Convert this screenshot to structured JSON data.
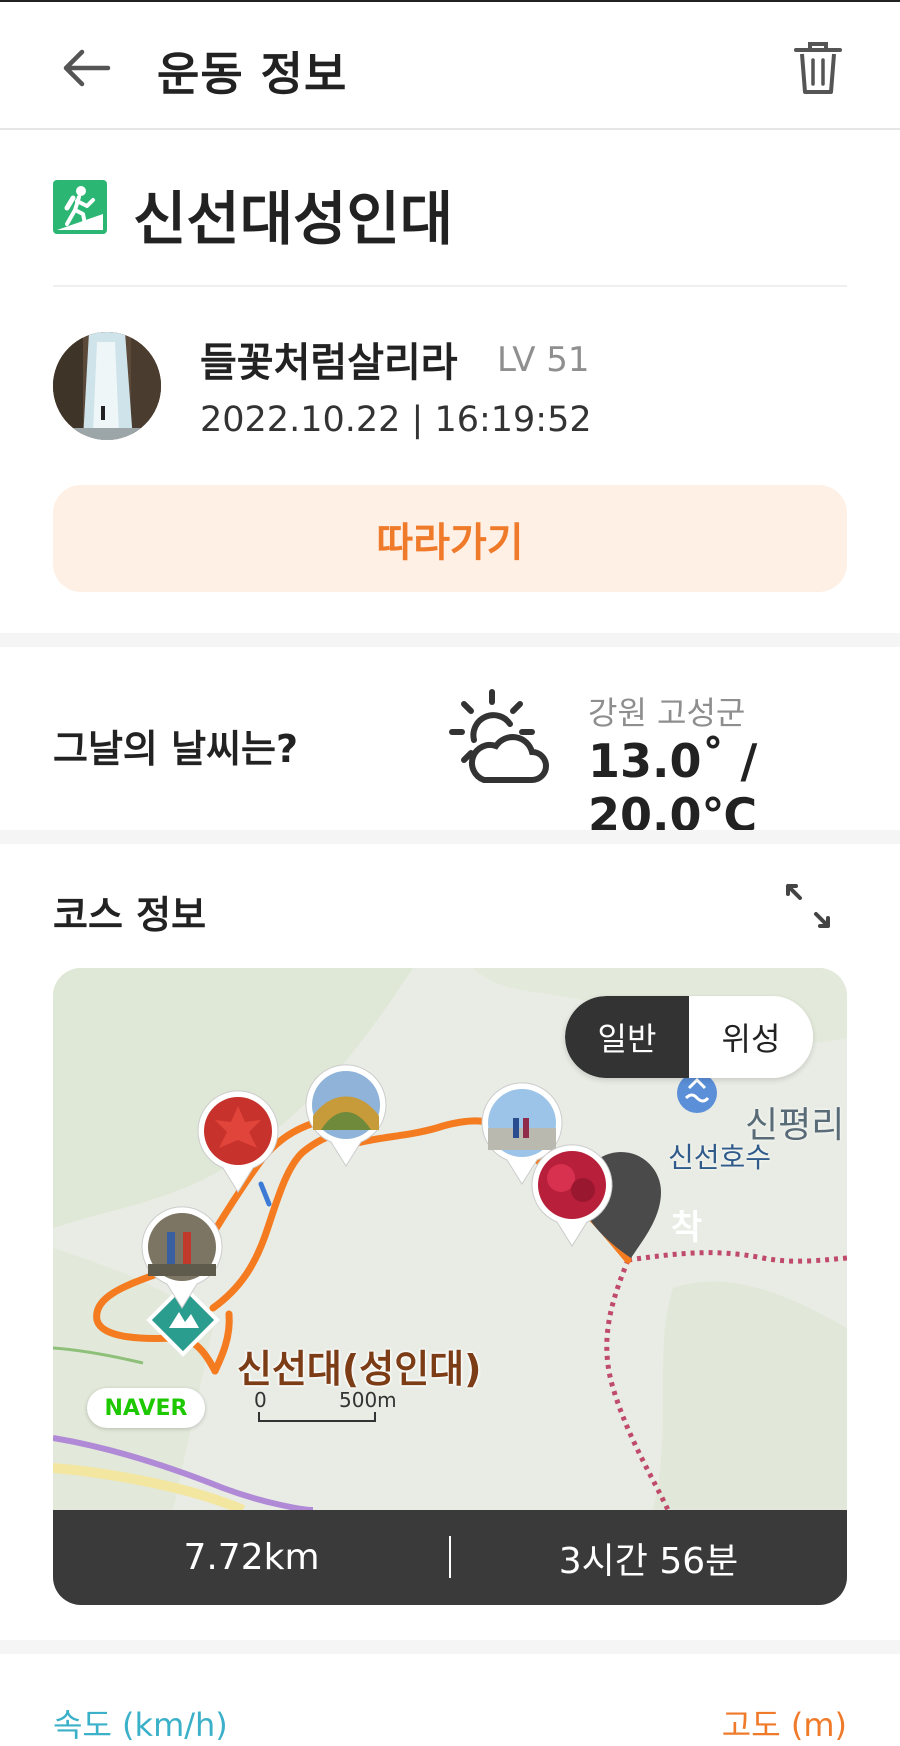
{
  "header": {
    "title": "운동 정보",
    "back_icon": "arrow-left-icon",
    "delete_icon": "trash-icon"
  },
  "activity": {
    "type_icon": "hiking-icon",
    "title": "신선대성인대"
  },
  "user": {
    "name": "들꽃처럼살리라",
    "level": "LV 51",
    "datetime": "2022.10.22 | 16:19:52"
  },
  "follow_button": {
    "label": "따라가기"
  },
  "weather": {
    "question": "그날의 날씨는?",
    "icon": "partly-cloudy-icon",
    "region": "강원 고성군",
    "temperature": "13.0˚ / 20.0℃"
  },
  "course": {
    "heading": "코스 정보",
    "expand_icon": "expand-icon",
    "map": {
      "toggle_options": [
        "일반",
        "위성"
      ],
      "selected": "일반",
      "place_label": "신선대(성인대)",
      "town_label": "신평리",
      "lake_label": "신선호수",
      "finish_label": "착",
      "provider_badge": "NAVER",
      "scale_start": "0",
      "scale_end": "500m"
    },
    "distance": "7.72km",
    "duration": "3시간 56분"
  },
  "chart_legend": {
    "speed": "속도 (km/h)",
    "altitude": "고도 (m)"
  },
  "colors": {
    "accent": "#ef7a2a",
    "accent_bg": "#fff0e6",
    "speed": "#3bb0c9",
    "icon_green": "#2bb673"
  }
}
